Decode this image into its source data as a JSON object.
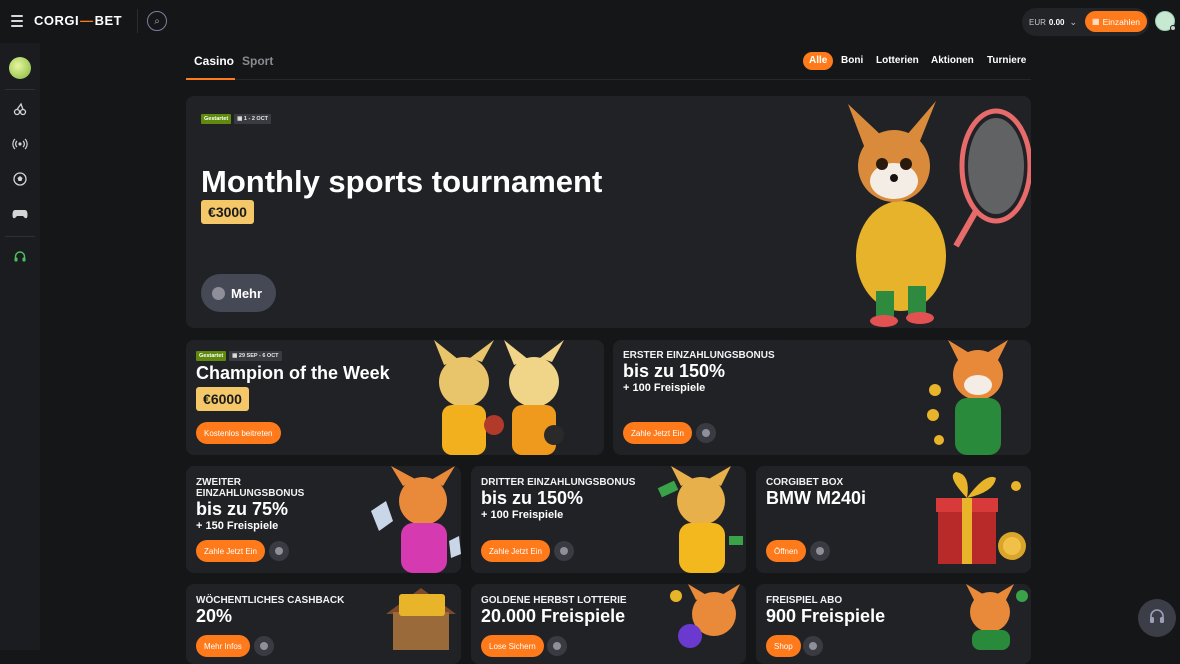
{
  "header": {
    "logo_left": "CORGI",
    "logo_mid": "—",
    "logo_right": "BET",
    "currency": "EUR",
    "balance": "0.00",
    "deposit_label": "Einzahlen",
    "icons": [
      "hamburger-icon",
      "search-icon",
      "chevron-down-icon",
      "wallet-icon"
    ]
  },
  "sidenav": {
    "items": [
      "promo-icon",
      "cherries-icon",
      "live-broadcast-icon",
      "football-icon",
      "gamepad-icon",
      "headset-icon"
    ]
  },
  "tabs": [
    {
      "label": "Casino",
      "active": true
    },
    {
      "label": "Sport",
      "active": false
    }
  ],
  "filters": [
    {
      "label": "Alle",
      "active": true
    },
    {
      "label": "Boni",
      "active": false
    },
    {
      "label": "Lotterien",
      "active": false
    },
    {
      "label": "Aktionen",
      "active": false
    },
    {
      "label": "Turniere",
      "active": false
    }
  ],
  "hero": {
    "status": "Gestartet",
    "dates": "1 - 2 OCT",
    "title": "Monthly sports tournament",
    "prize": "€3000",
    "more_label": "Mehr"
  },
  "champion": {
    "status": "Gestartet",
    "dates": "29 SEP - 6 OCT",
    "title": "Champion of the Week",
    "prize": "€6000",
    "button": "Kostenlos beitreten"
  },
  "first_bonus": {
    "label": "ERSTER EINZAHLUNGSBONUS",
    "title": "bis zu 150%",
    "sub": "+ 100 Freispiele",
    "button": "Zahle Jetzt Ein"
  },
  "second_bonus": {
    "label_line1": "ZWEITER",
    "label_line2": "EINZAHLUNGSBONUS",
    "title": "bis zu 75%",
    "sub": "+ 150 Freispiele",
    "button": "Zahle Jetzt Ein"
  },
  "third_bonus": {
    "label": "DRITTER EINZAHLUNGSBONUS",
    "title": "bis zu 150%",
    "sub": "+ 100 Freispiele",
    "button": "Zahle Jetzt Ein"
  },
  "box": {
    "label": "CORGIBET BOX",
    "title": "BMW M240i",
    "button": "Öffnen"
  },
  "cashback": {
    "label": "WÖCHENTLICHES CASHBACK",
    "title": "20%",
    "button": "Mehr Infos"
  },
  "lottery": {
    "label": "GOLDENE HERBST LOTTERIE",
    "title": "20.000 Freispiele",
    "button": "Lose Sichern"
  },
  "freespin": {
    "label": "FREISPIEL ABO",
    "title": "900 Freispiele",
    "button": "Shop"
  },
  "colors": {
    "accent": "#ff7a1a",
    "badge_green": "#5f8a0d",
    "prize_gold": "#f4c869",
    "card_bg": "#212226",
    "page_bg": "#151618"
  }
}
